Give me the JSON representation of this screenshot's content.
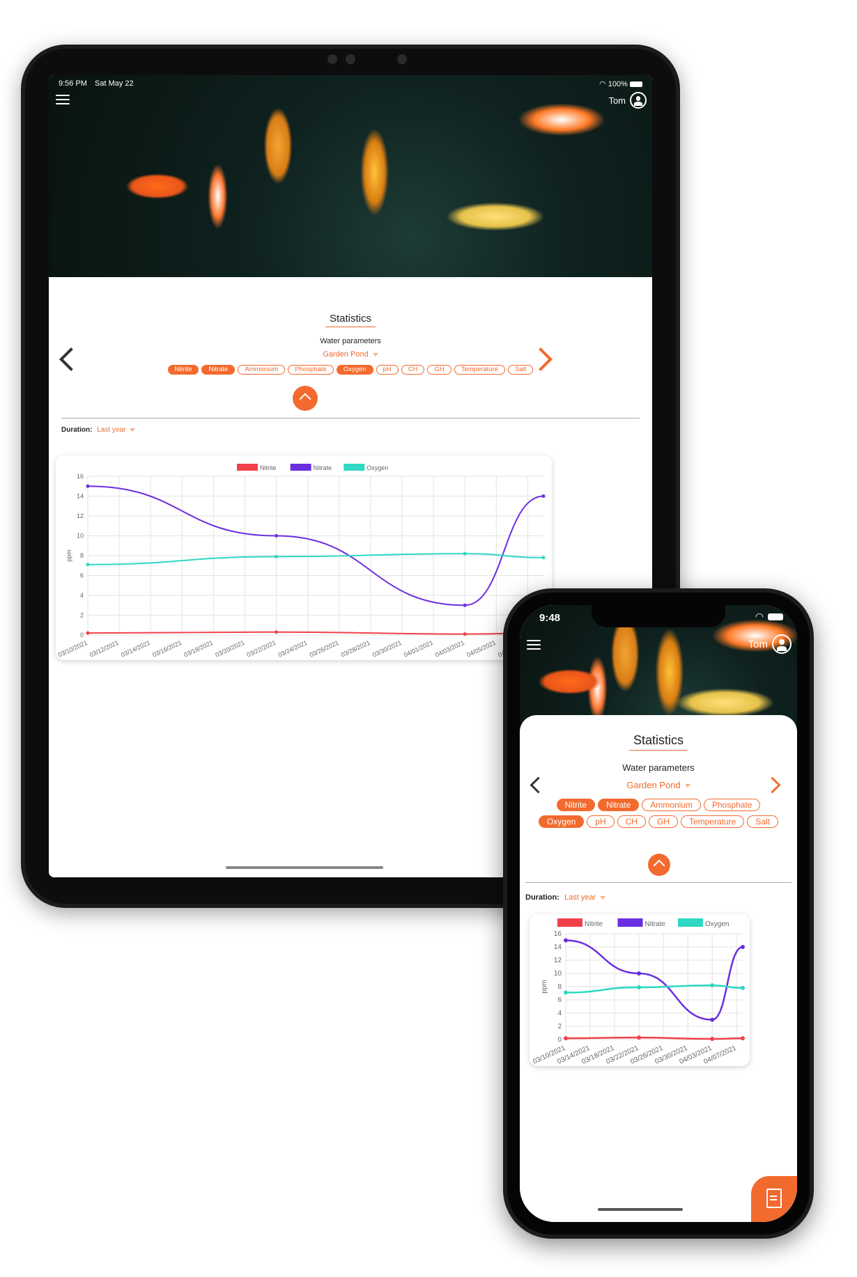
{
  "tablet": {
    "status": {
      "time": "9:56 PM",
      "date": "Sat May 22",
      "battery": "100%"
    },
    "user_name": "Tom",
    "title": "Statistics",
    "subtitle": "Water parameters",
    "pond": "Garden Pond",
    "duration_label": "Duration:",
    "duration_value": "Last year"
  },
  "phone": {
    "status": {
      "time": "9:48"
    },
    "user_name": "Tom",
    "title": "Statistics",
    "subtitle": "Water parameters",
    "pond": "Garden Pond",
    "duration_label": "Duration:",
    "duration_value": "Last year"
  },
  "parameters": [
    {
      "label": "Nitrite",
      "selected": true
    },
    {
      "label": "Nitrate",
      "selected": true
    },
    {
      "label": "Ammonium",
      "selected": false
    },
    {
      "label": "Phosphate",
      "selected": false
    },
    {
      "label": "Oxygen",
      "selected": true
    },
    {
      "label": "pH",
      "selected": false
    },
    {
      "label": "CH",
      "selected": false
    },
    {
      "label": "GH",
      "selected": false
    },
    {
      "label": "Temperature",
      "selected": false
    },
    {
      "label": "Salt",
      "selected": false
    }
  ],
  "colors": {
    "accent": "#f26a2e",
    "nitrite": "#f2404a",
    "nitrate": "#6b2ee0",
    "oxygen": "#2ed8c3"
  },
  "chart_data": {
    "type": "line",
    "ylabel": "ppm",
    "ylim": [
      0,
      16
    ],
    "yticks": [
      0,
      2,
      4,
      6,
      8,
      10,
      12,
      14,
      16
    ],
    "tablet_xticks": [
      "03/10/2021",
      "03/12/2021",
      "03/14/2021",
      "03/16/2021",
      "03/18/2021",
      "03/20/2021",
      "03/22/2021",
      "03/24/2021",
      "03/26/2021",
      "03/28/2021",
      "03/30/2021",
      "04/01/2021",
      "04/03/2021",
      "04/05/2021",
      "04/07/2021"
    ],
    "phone_xticks": [
      "03/10/2021",
      "03/14/2021",
      "03/18/2021",
      "03/22/2021",
      "03/26/2021",
      "03/30/2021",
      "04/03/2021",
      "04/07/2021"
    ],
    "legend": [
      "Nitrite",
      "Nitrate",
      "Oxygen"
    ],
    "x": [
      "03/10/2021",
      "03/22/2021",
      "04/03/2021",
      "04/08/2021"
    ],
    "series": [
      {
        "name": "Nitrite",
        "color": "#f2404a",
        "values": [
          0.2,
          0.3,
          0.1,
          0.2
        ]
      },
      {
        "name": "Nitrate",
        "color": "#6b2ee0",
        "values": [
          15,
          10,
          3,
          14
        ]
      },
      {
        "name": "Oxygen",
        "color": "#2ed8c3",
        "values": [
          7.1,
          7.9,
          8.2,
          7.8
        ]
      }
    ]
  }
}
